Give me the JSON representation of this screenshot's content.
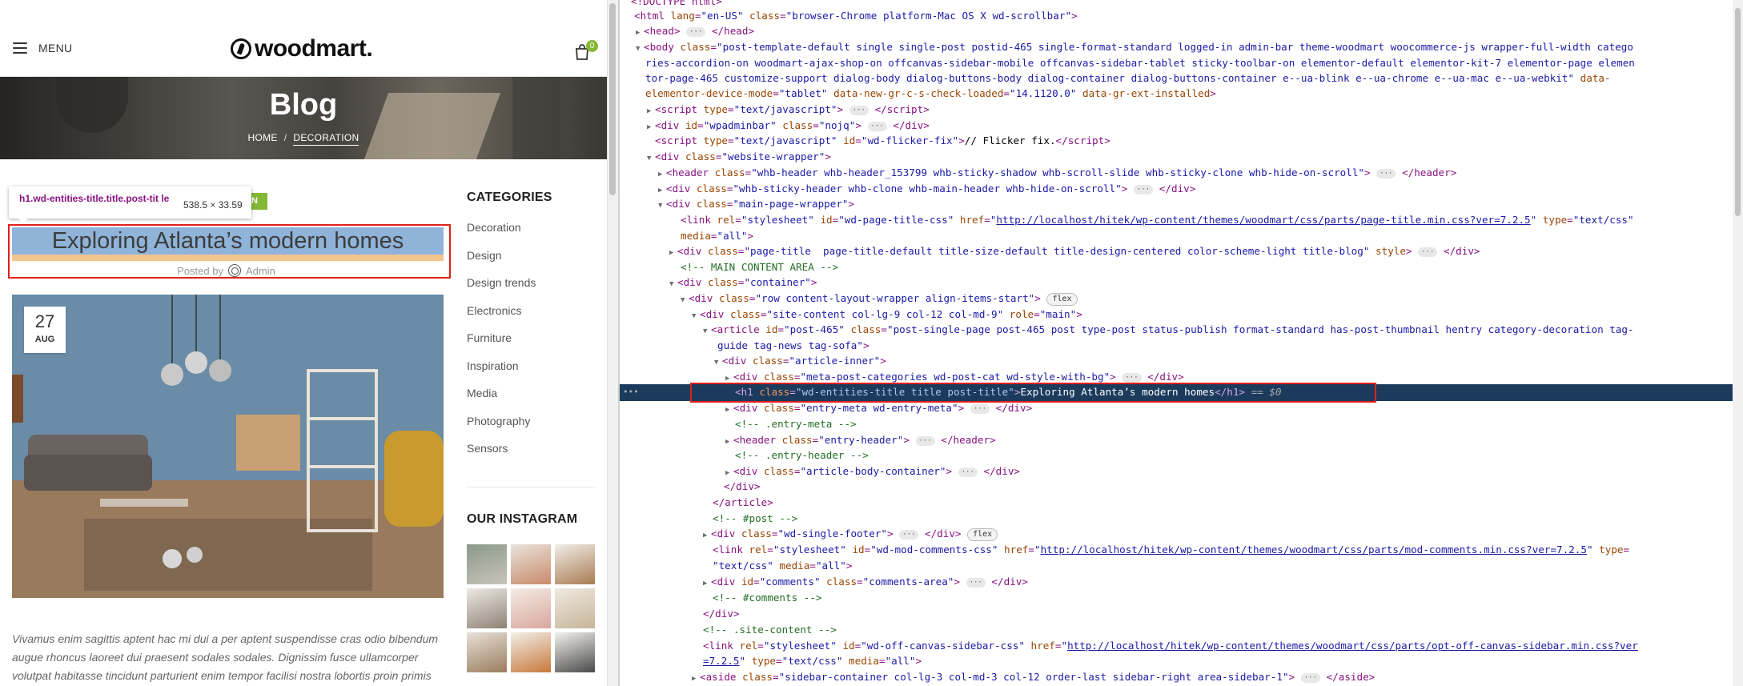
{
  "site": {
    "menu_label": "MENU",
    "logo_text": "woodmart.",
    "cart_count": "0",
    "hero_title": "Blog",
    "breadcrumb": [
      "HOME",
      "/",
      "DECORATION"
    ],
    "category_badge": "N",
    "tooltip": {
      "selector": "h1.wd-entities-title.title.post-tit le",
      "dimensions": "538.5 × 33.59"
    },
    "post_title": "Exploring Atlanta’s modern homes",
    "posted_by_label": "Posted by",
    "author": "Admin",
    "date_day": "27",
    "date_month": "AUG",
    "excerpt": "Vivamus enim sagittis aptent hac mi dui a per aptent suspendisse cras odio bibendum augue rhoncus laoreet dui praesent sodales sodales. Dignissim fusce ullamcorper volutpat habitasse tincidunt parturient enim tempor facilisi nostra lobortis proin primis",
    "sidebar": {
      "categories_title": "CATEGORIES",
      "categories": [
        "Decoration",
        "Design",
        "Design trends",
        "Electronics",
        "Furniture",
        "Inspiration",
        "Media",
        "Photography",
        "Sensors"
      ],
      "instagram_title": "OUR INSTAGRAM"
    },
    "colors": {
      "accent": "#83b735",
      "highlight": "#8fb3d9",
      "padding": "#f2c48d",
      "annotation": "#e0201a"
    }
  },
  "devtools": {
    "lines": {
      "l0": "<!DOCTYPE html>",
      "l1_cls": "browser-Chrome platform-Mac OS X wd-scrollbar",
      "body_cls_1": "post-template-default single single-post postid-465 single-format-standard logged-in admin-bar theme-woodmart woocommerce-js wrapper-full-width catego",
      "body_cls_2": "ries-accordion-on woodmart-ajax-shop-on offcanvas-sidebar-mobile offcanvas-sidebar-tablet sticky-toolbar-on elementor-default elementor-kit-7 elementor-page elemen",
      "body_cls_3": "tor-page-465 customize-support dialog-body dialog-buttons-body dialog-container dialog-buttons-container e--ua-blink e--ua-chrome e--ua-mac e--ua-webkit",
      "body_cls_3b": " data-",
      "body_cls_4a": "elementor-device-mode",
      "body_cls_4b": "tablet",
      "body_cls_4c": "14.1120.0",
      "flicker": "// Flicker fix.",
      "header_cls": "whb-header whb-header_153799 whb-sticky-shadow whb-scroll-slide whb-sticky-clone whb-hide-on-scroll",
      "sticky_cls": "whb-sticky-header whb-clone whb-main-header whb-hide-on-scroll",
      "page_title_href": "http://localhost/hitek/wp-content/themes/woodmart/css/parts/page-title.min.css?ver=7.2.5",
      "page_title_div_cls": "page-title  page-title-default title-size-default title-design-centered color-scheme-light title-blog",
      "main_cmt": "<!-- MAIN CONTENT AREA -->",
      "row_cls": "row content-layout-wrapper align-items-start",
      "site_content_cls": "site-content col-lg-9 col-12 col-md-9",
      "article_cls_1": "post-single-page post-465 post type-post status-publish format-standard has-post-thumbnail hentry category-decoration tag-",
      "article_cls_2": "guide tag-news tag-sofa",
      "meta_cls": "meta-post-categories wd-post-cat wd-style-with-bg",
      "h1_cls": "wd-entities-title title post-title",
      "h1_text": "Exploring Atlanta’s modern homes",
      "sel_marker": "== $0",
      "entry_meta_cls": "entry-meta wd-entry-meta",
      "cmt_entry_meta": "<!-- .entry-meta -->",
      "cmt_entry_header": "<!-- .entry-header -->",
      "article_body_cls": "article-body-container",
      "cmt_post": "<!-- #post -->",
      "single_footer_cls": "wd-single-footer",
      "comments_href": "http://localhost/hitek/wp-content/themes/woodmart/css/parts/mod-comments.min.css?ver=7.2.5",
      "cmt_comments": "<!-- #comments -->",
      "cmt_site_content": "<!-- .site-content -->",
      "offcanvas_href_1": "http://localhost/hitek/wp-content/themes/woodmart/css/parts/opt-off-canvas-sidebar.min.css?ver",
      "offcanvas_href_2": "=7.2.5",
      "aside_cls": "sidebar-container col-lg-3 col-md-3 col-12 order-last sidebar-right area-sidebar-1"
    },
    "badge_flex": "flex"
  }
}
